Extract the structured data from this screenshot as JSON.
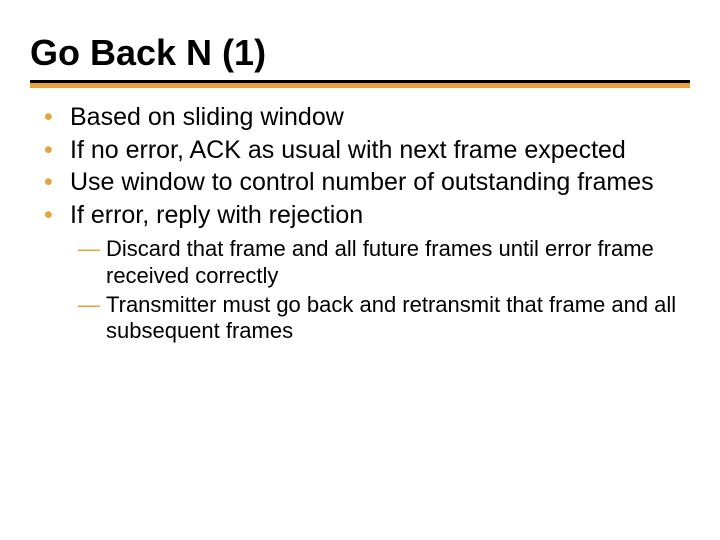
{
  "colors": {
    "accent": "#e8a33d",
    "text": "#000000",
    "rule": "#000000"
  },
  "title": "Go Back N (1)",
  "bullets": [
    {
      "text": "Based on sliding window"
    },
    {
      "text": "If no error, ACK as usual with next frame expected"
    },
    {
      "text": "Use window to control number of outstanding frames"
    },
    {
      "text": "If error, reply with rejection"
    }
  ],
  "subbullets": [
    {
      "text": "Discard that frame and all future frames until error frame received correctly"
    },
    {
      "text": "Transmitter must go back and retransmit that frame and all subsequent frames"
    }
  ]
}
